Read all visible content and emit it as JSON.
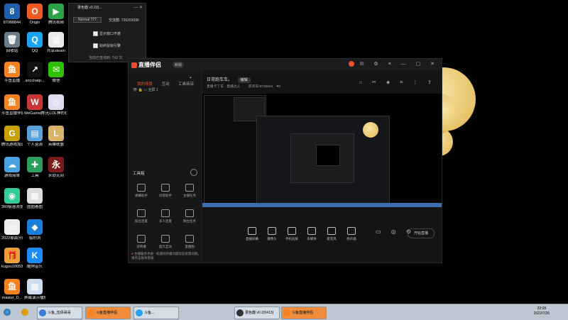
{
  "desktop": {
    "icons": [
      {
        "label": "87088844",
        "color": "#1e5fa8",
        "glyph": "8"
      },
      {
        "label": "Origin",
        "color": "#f15a22",
        "glyph": "O"
      },
      {
        "label": "腾讯视频",
        "color": "#2ba245",
        "glyph": "▶"
      },
      {
        "label": "回收站",
        "color": "#6b7a8a",
        "glyph": "🗑"
      },
      {
        "label": "QQ",
        "color": "#1aa3f0",
        "glyph": "Q"
      },
      {
        "label": "共享steam",
        "color": "#eaeaea",
        "glyph": "▦"
      },
      {
        "label": "斗鱼直播",
        "color": "#f6821f",
        "glyph": "鱼"
      },
      {
        "label": "ancchatp...",
        "color": "#111",
        "glyph": "↗"
      },
      {
        "label": "微信",
        "color": "#2dc100",
        "glyph": "✉"
      },
      {
        "label": "斗鱼直播伴侣",
        "color": "#f6821f",
        "glyph": "鱼"
      },
      {
        "label": "WeGame腾讯平台",
        "color": "#c93636",
        "glyph": "W"
      },
      {
        "label": "无LOL神的社切换器",
        "color": "#dde",
        "glyph": "◎"
      },
      {
        "label": "腾讯游戏加速器",
        "color": "#c8a000",
        "glyph": "G"
      },
      {
        "label": "个人资源",
        "color": "#5aa0d8",
        "glyph": "▤"
      },
      {
        "label": "英雄联盟",
        "color": "#d8b46a",
        "glyph": "L"
      },
      {
        "label": "游戏简单",
        "color": "#4aa3df",
        "glyph": "☁"
      },
      {
        "label": "工具",
        "color": "#2e9e5e",
        "glyph": "✚"
      },
      {
        "label": "永劫无间",
        "color": "#7a1a1a",
        "glyph": "永"
      },
      {
        "label": "360极速浏览器",
        "color": "#3c9",
        "glyph": "◉"
      },
      {
        "label": "图图看图",
        "color": "#ddd",
        "glyph": "▦"
      },
      {
        "label": "2022桌面分辨率",
        "color": "#eee",
        "glyph": "▭"
      },
      {
        "label": "猎豹浏",
        "color": "#1a7fd8",
        "glyph": "◆"
      },
      {
        "label": "kugou10053",
        "color": "#e9a23b",
        "glyph": "🎁"
      },
      {
        "label": "酷狗音乐",
        "color": "#1a8cff",
        "glyph": "K"
      },
      {
        "label": "master_D...",
        "color": "#f6821f",
        "glyph": "鱼"
      },
      {
        "label": "屏幕演示播放",
        "color": "#cde",
        "glyph": "▦"
      }
    ]
  },
  "tool_window": {
    "title": "录色器 v0.2(0...",
    "version_select": "Normal 777",
    "qq_label": "交流群:",
    "qq_value": "726203090",
    "opt1": "显示窗口不遮",
    "opt2": "始终鼠标引擎",
    "footer": "当前已查询到: 742 次"
  },
  "app": {
    "title": "直播伴侣",
    "version": "新版",
    "tabs": [
      "我的场景",
      "互动",
      "工具商店"
    ],
    "scene_label": "全屏 1",
    "stream_title": "日常跑车车。",
    "edit_btn": "编辑",
    "category": "直播卡丁车 · 直播达人",
    "room_label": "房间号:",
    "room_id": "8735844",
    "likes": "0",
    "tools_header": "工具箱",
    "tools": [
      "弹幕助手",
      "房管助手",
      "主播任务",
      "粉丝连麦",
      "多人连麦",
      "粉丝任务",
      "逆转播",
      "超凡互动",
      "直播图"
    ],
    "notice": "主播服务手册 · 如遇到开播问题欢迎反馈问题，请点击联系客服",
    "controls": [
      "直播屏幕",
      "摄像头",
      "手机投屏",
      "多媒体",
      "麦克风",
      "扬声器"
    ],
    "start_label": "开始直播"
  },
  "taskbar": {
    "items": [
      "斗鱼_伍佰哥哥",
      "斗鱼直播伴侣",
      "斗鱼...",
      "录色器 v0.2(0413)",
      "斗鱼直播伴侣"
    ],
    "time": "22:08",
    "date": "2022/7/26"
  }
}
